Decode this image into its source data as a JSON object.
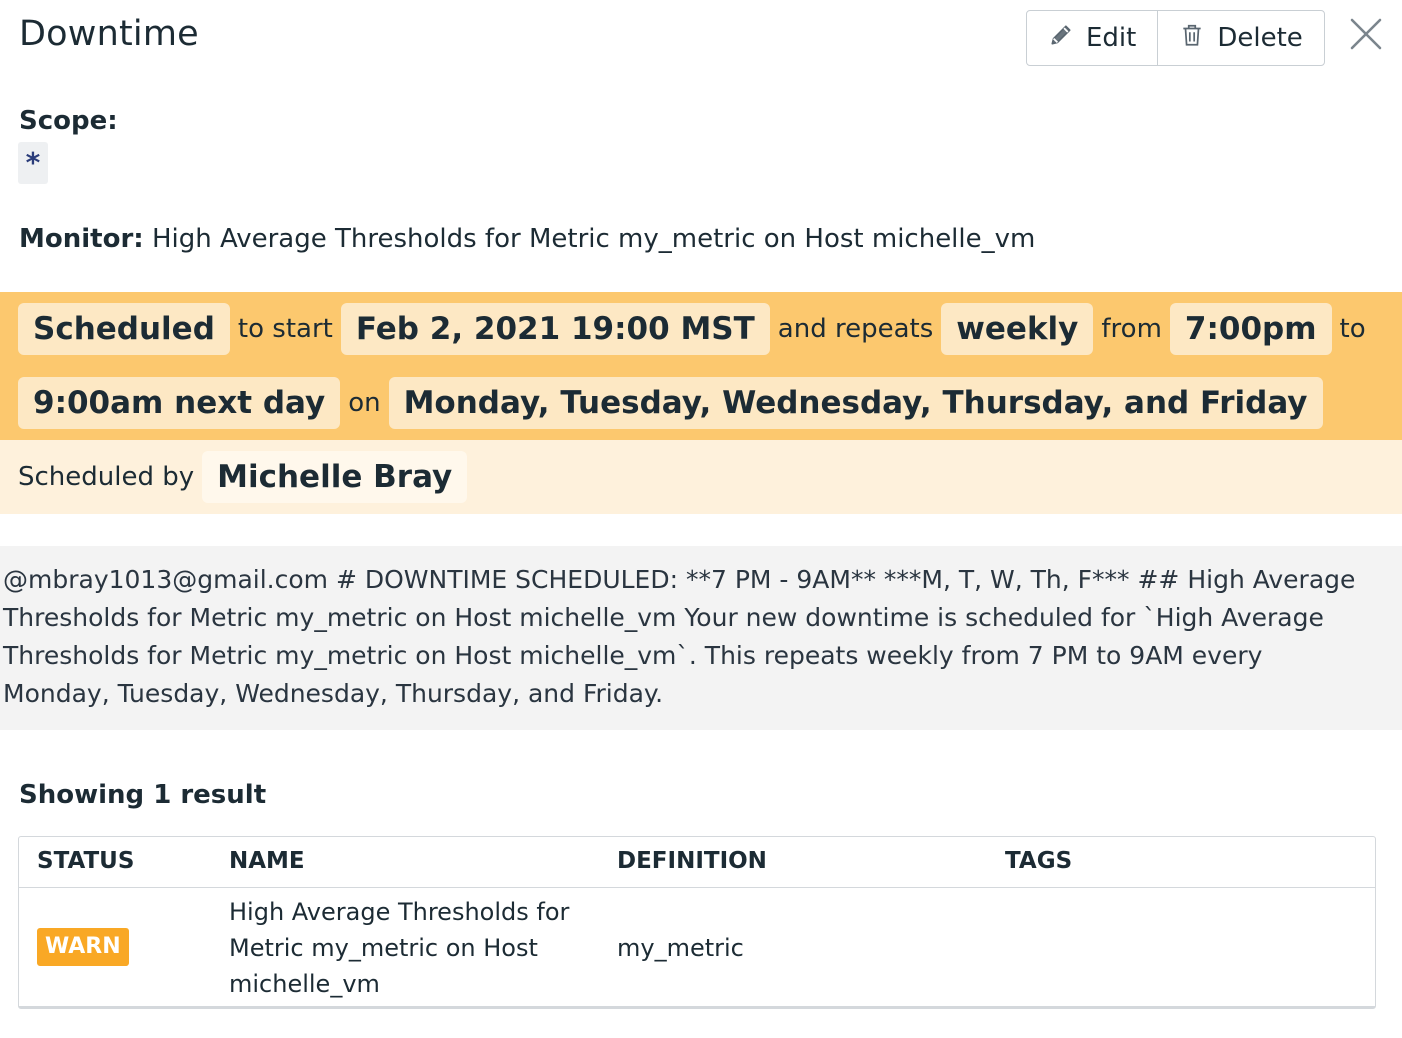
{
  "header": {
    "title": "Downtime",
    "edit_label": "Edit",
    "delete_label": "Delete"
  },
  "scope": {
    "label": "Scope:",
    "value": "*"
  },
  "monitor": {
    "label": "Monitor:",
    "value": "High Average Thresholds for Metric my_metric on Host michelle_vm"
  },
  "schedule": {
    "status": "Scheduled",
    "to_start": "to start",
    "start": "Feb 2, 2021 19:00 MST",
    "and_repeats": "and repeats",
    "frequency": "weekly",
    "from": "from",
    "from_time": "7:00pm",
    "to": "to",
    "to_time": "9:00am next day",
    "on": "on",
    "days": "Monday, Tuesday, Wednesday, Thursday, and Friday",
    "scheduled_by_label": "Scheduled by",
    "scheduled_by": "Michelle Bray"
  },
  "message": "@mbray1013@gmail.com # DOWNTIME SCHEDULED: **7 PM - 9AM** ***M, T, W, Th, F*** ## High Average Thresholds for Metric my_metric on Host michelle_vm Your new downtime is scheduled for `High Average Thresholds for Metric my_metric on Host michelle_vm`. This repeats weekly from 7 PM to 9AM every Monday, Tuesday, Wednesday, Thursday, and Friday.",
  "results": {
    "title": "Showing 1 result",
    "columns": [
      "STATUS",
      "NAME",
      "DEFINITION",
      "TAGS"
    ],
    "rows": [
      {
        "status": "WARN",
        "name": "High Average Thresholds for Metric my_metric on Host michelle_vm",
        "definition": "my_metric",
        "tags": ""
      }
    ]
  },
  "colors": {
    "schedule_band": "#fcc86e",
    "scheduled_by_band": "#fef1dc",
    "warn_badge": "#f9a825"
  },
  "icons": [
    "pencil-icon",
    "trash-icon",
    "close-icon"
  ]
}
